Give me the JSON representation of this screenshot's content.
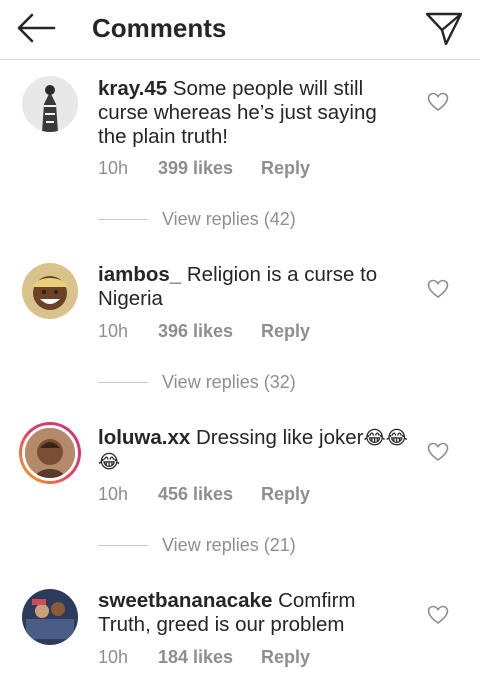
{
  "header": {
    "title": "Comments",
    "back_icon": "arrow-left-icon",
    "send_icon": "paper-plane-icon"
  },
  "comments": [
    {
      "username": "kray.45",
      "text": "Some people will still curse whereas he’s just saying the plain truth!",
      "emoji": "",
      "time": "10h",
      "likes": "399 likes",
      "reply": "Reply",
      "view_replies": "View replies (42)"
    },
    {
      "username": "iambos_",
      "text": "Religion is a curse to Nigeria",
      "emoji": "",
      "time": "10h",
      "likes": "396 likes",
      "reply": "Reply",
      "view_replies": "View replies (32)"
    },
    {
      "username": "loluwa.xx",
      "text": "Dressing like joker",
      "emoji": "😂😂😂",
      "time": "10h",
      "likes": "456 likes",
      "reply": "Reply",
      "view_replies": "View replies (21)"
    },
    {
      "username": "sweetbananacake",
      "text": "Comfirm Truth, greed is our problem",
      "emoji": "",
      "time": "10h",
      "likes": "184 likes",
      "reply": "Reply"
    }
  ],
  "colors": {
    "text": "#262626",
    "secondary": "#8e8e8e",
    "divider": "#dbdbdb"
  }
}
